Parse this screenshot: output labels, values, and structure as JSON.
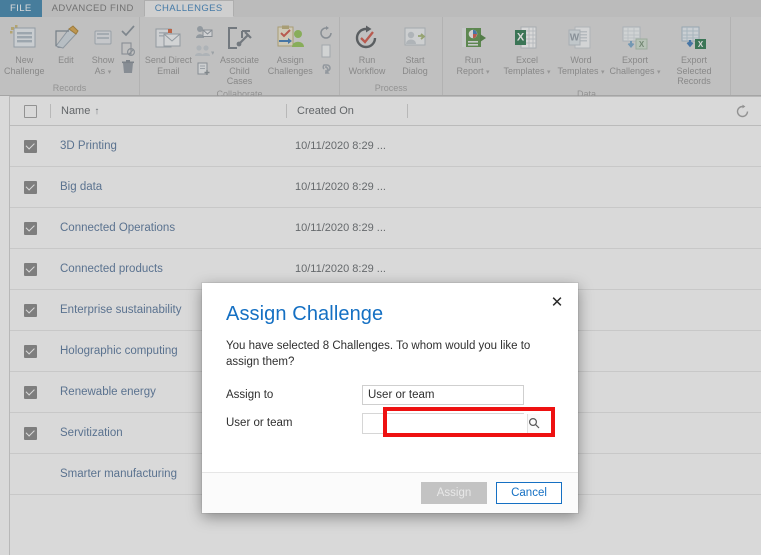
{
  "tabs": [
    {
      "id": "file",
      "label": "FILE",
      "state": "file"
    },
    {
      "id": "advanced-find",
      "label": "ADVANCED FIND",
      "state": "plain"
    },
    {
      "id": "challenges",
      "label": "CHALLENGES",
      "state": "active"
    }
  ],
  "header": {
    "user_chip": "",
    "colors": {
      "file_tab": "#2e7ca8",
      "active_tab_text": "#2b78b8"
    }
  },
  "ribbon": {
    "groups": [
      {
        "name": "Records",
        "label": "Records",
        "commands": [
          {
            "name": "new-challenge",
            "label": "New\nChallenge",
            "icon": "new-record-icon"
          },
          {
            "name": "edit",
            "label": "Edit",
            "icon": "edit-pencil-icon"
          },
          {
            "name": "show-as",
            "label": "Show\nAs",
            "icon": "show-as-icon",
            "caret": true
          }
        ],
        "small_commands": [
          {
            "name": "activate",
            "icon": "checkmark-icon"
          },
          {
            "name": "deactivate",
            "icon": "document-block-icon"
          },
          {
            "name": "delete",
            "icon": "trash-icon"
          }
        ]
      },
      {
        "name": "Collaborate",
        "label": "Collaborate",
        "commands": [
          {
            "name": "send-direct-email",
            "label": "Send Direct\nEmail",
            "icon": "email-document-icon"
          },
          {
            "name": "associate-child-cases",
            "label": "Associate Child\nCases",
            "icon": "bracket-wrench-icon"
          },
          {
            "name": "assign-challenges",
            "label": "Assign\nChallenges",
            "icon": "assign-clipboard-icon"
          }
        ],
        "mini_commands": [
          {
            "name": "connect",
            "icon": "person-email-icon"
          },
          {
            "name": "add-connection",
            "icon": "people-icon",
            "caret": true
          },
          {
            "name": "add-to-queue",
            "icon": "queue-icon"
          }
        ],
        "mini_commands_2": [
          {
            "name": "share",
            "icon": "share-refresh-icon"
          },
          {
            "name": "copy-a-link",
            "icon": "page-icon"
          },
          {
            "name": "connect-link",
            "icon": "link-icon"
          }
        ]
      },
      {
        "name": "Process",
        "label": "Process",
        "commands": [
          {
            "name": "run-workflow",
            "label": "Run\nWorkflow",
            "icon": "run-workflow-icon"
          },
          {
            "name": "start-dialog",
            "label": "Start\nDialog",
            "icon": "start-dialog-icon"
          }
        ]
      },
      {
        "name": "Data",
        "label": "Data",
        "commands": [
          {
            "name": "run-report",
            "label": "Run\nReport",
            "icon": "run-report-icon",
            "caret": true
          },
          {
            "name": "excel-templates",
            "label": "Excel\nTemplates",
            "icon": "excel-icon",
            "caret": true
          },
          {
            "name": "word-templates",
            "label": "Word\nTemplates",
            "icon": "word-icon",
            "caret": true
          },
          {
            "name": "export-challenges",
            "label": "Export\nChallenges",
            "icon": "export-excel-icon",
            "caret": true
          },
          {
            "name": "export-selected-records",
            "label": "Export Selected\nRecords",
            "icon": "export-selected-icon"
          }
        ]
      }
    ]
  },
  "grid": {
    "columns": [
      {
        "key": "name",
        "label": "Name",
        "sorted": "asc",
        "sort_glyph": "↑"
      },
      {
        "key": "created_on",
        "label": "Created On"
      }
    ],
    "select_all_checked": false,
    "refresh_icon": "refresh-icon",
    "rows": [
      {
        "name": "3D Printing",
        "created_on": "10/11/2020 8:29 ...",
        "selected": true
      },
      {
        "name": "Big data",
        "created_on": "10/11/2020 8:29 ...",
        "selected": true
      },
      {
        "name": "Connected Operations",
        "created_on": "10/11/2020 8:29 ...",
        "selected": true
      },
      {
        "name": "Connected products",
        "created_on": "10/11/2020 8:29 ...",
        "selected": true
      },
      {
        "name": "Enterprise sustainability",
        "created_on": "10/11/2020 8:29 ...",
        "selected": true
      },
      {
        "name": "Holographic computing",
        "created_on": "",
        "selected": true
      },
      {
        "name": "Renewable energy",
        "created_on": "",
        "selected": true
      },
      {
        "name": "Servitization",
        "created_on": "",
        "selected": true
      },
      {
        "name": "Smarter manufacturing",
        "created_on": "",
        "selected": false
      }
    ]
  },
  "dialog": {
    "title": "Assign Challenge",
    "close_icon": "close-icon",
    "message": "You have selected 8 Challenges. To whom would you like to assign them?",
    "fields": [
      {
        "name": "assign-to",
        "label": "Assign to",
        "value": "User or team",
        "placeholder": ""
      },
      {
        "name": "user-or-team",
        "label": "User or team",
        "value": "",
        "placeholder": "",
        "lookup_icon": "search-icon",
        "highlighted": true
      }
    ],
    "buttons": [
      {
        "name": "assign-button",
        "label": "Assign",
        "style": "disabled"
      },
      {
        "name": "cancel-button",
        "label": "Cancel",
        "style": "outline"
      }
    ],
    "highlight_color": "#ee1111"
  }
}
